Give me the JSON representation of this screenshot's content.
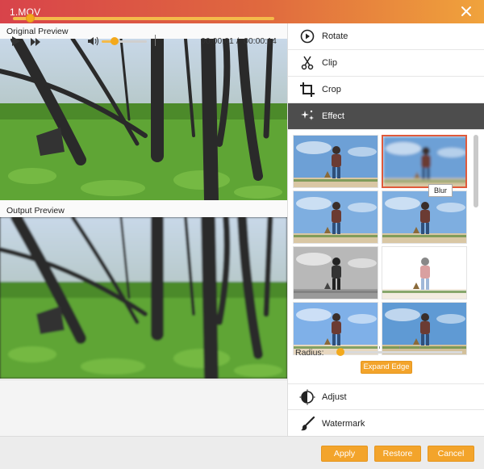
{
  "window": {
    "title": "1.MOV"
  },
  "left": {
    "original_label": "Original Preview",
    "output_label": "Output Preview"
  },
  "player": {
    "current_time": "00:00:01",
    "separator": "/",
    "total_time": "00:00:14",
    "progress_fraction": 0.07,
    "volume_fraction": 0.25
  },
  "menu": {
    "rotate": "Rotate",
    "clip": "Clip",
    "crop": "Crop",
    "effect": "Effect",
    "adjust": "Adjust",
    "watermark": "Watermark"
  },
  "effects": {
    "tooltip": "Blur",
    "radius_label": "Radius:",
    "expand_edge": "Expand Edge",
    "radius_fraction": 0.0
  },
  "footer": {
    "apply": "Apply",
    "restore": "Restore",
    "cancel": "Cancel"
  },
  "colors": {
    "accent": "#f3a42b",
    "title_gradient_start": "#d8434a",
    "title_gradient_end": "#f0a33c",
    "active_menu": "#4d4d4d",
    "selected_border": "#e05a3b"
  }
}
